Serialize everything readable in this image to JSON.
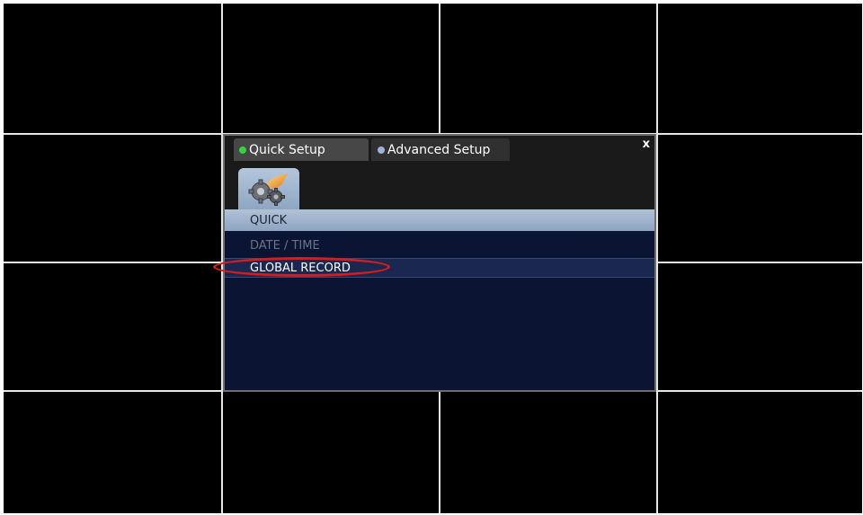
{
  "dialog": {
    "close_label": "x",
    "tabs": [
      {
        "label": "Quick Setup",
        "status_color": "#37d144",
        "active": true
      },
      {
        "label": "Advanced Setup",
        "status_color": "#9fb3d8",
        "active": false
      }
    ],
    "category_icon": "gears-icon",
    "menu": {
      "header": "QUICK",
      "items": [
        {
          "label": "DATE / TIME",
          "enabled": false
        },
        {
          "label": "GLOBAL RECORD",
          "enabled": true,
          "highlighted": true
        }
      ]
    }
  },
  "annotation": {
    "color": "#d81c1c",
    "target": "GLOBAL RECORD"
  },
  "camera_grid": {
    "columns": 4,
    "rows": 4
  }
}
